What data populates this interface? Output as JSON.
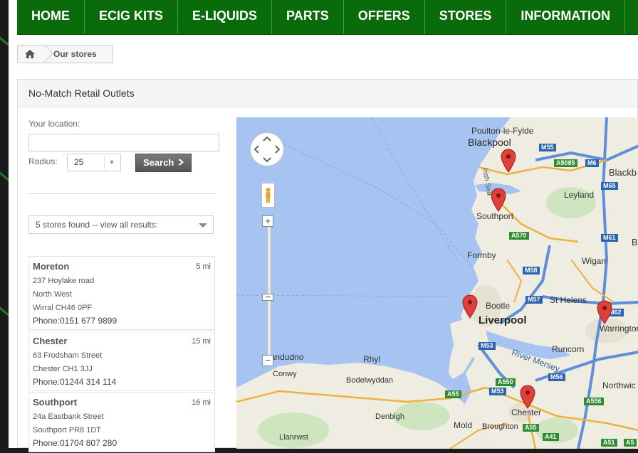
{
  "nav": {
    "items": [
      "HOME",
      "ECIG KITS",
      "E-LIQUIDS",
      "PARTS",
      "OFFERS",
      "STORES",
      "INFORMATION"
    ]
  },
  "breadcrumb": {
    "home_icon": "home-icon",
    "current": "Our stores"
  },
  "panel": {
    "title": "No-Match Retail Outlets"
  },
  "form": {
    "location_label": "Your location:",
    "location_value": "",
    "radius_label": "Radius:",
    "radius_value": "25",
    "search_label": "Search",
    "results_label": "5 stores found -- view all results:"
  },
  "stores": [
    {
      "name": "Moreton",
      "distance": "5 mi",
      "address": [
        "237 Hoylake road",
        "North West",
        "Wirral CH46 0PF"
      ],
      "phone": "Phone:0151 677 9899"
    },
    {
      "name": "Chester",
      "distance": "15 mi",
      "address": [
        "63 Frodsham Street",
        "Chester CH1 3JJ"
      ],
      "phone": "Phone:01244 314 114"
    },
    {
      "name": "Southport",
      "distance": "16 mi",
      "address": [
        "24a Eastbank Street",
        "Southport PR8 1DT"
      ],
      "phone": "Phone:01704 807 280"
    }
  ],
  "map": {
    "places": {
      "poulton": "Poulton-le-Fylde",
      "blackpool": "Blackpool",
      "blackb": "Blackb",
      "leyland": "Leyland",
      "irish_sea": "Irish Sea",
      "southport": "Southport",
      "formby": "Formby",
      "wigan": "Wigan",
      "bootle": "Bootle",
      "st_helens": "St Helens",
      "liverpool": "Liverpool",
      "warrington": "Warrington",
      "runcorn": "Runcorn",
      "river": "River Mersey",
      "landudno": "landudno",
      "conwy": "Conwy",
      "rhyl": "Rhyl",
      "bodelwyddan": "Bodelwyddan",
      "northwich": "Northwic",
      "chester": "Chester",
      "denbigh": "Denbigh",
      "mold": "Mold",
      "broughton": "Broughton",
      "llanrwst": "Llanrwst",
      "b": "B"
    },
    "roads": [
      "M55",
      "A5085",
      "M6",
      "M65",
      "A570",
      "M61",
      "M58",
      "M57",
      "M62",
      "M53",
      "M56",
      "A550",
      "M53",
      "A55",
      "A556",
      "A55",
      "A41",
      "A51",
      "A5"
    ],
    "zoom_in": "+",
    "zoom_out": "−",
    "zoom_out2": "−"
  },
  "colors": {
    "nav_bg": "#0a6b0a",
    "water": "#a6c3f2",
    "land": "#f0ede4",
    "pin": "#e0403a"
  }
}
